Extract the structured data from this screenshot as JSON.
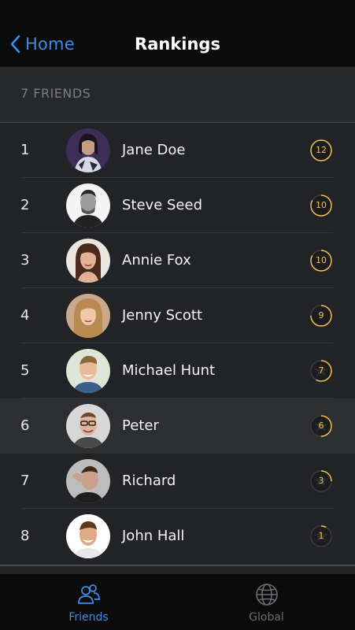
{
  "nav": {
    "back_label": "Home",
    "title": "Rankings"
  },
  "section": {
    "header": "7 FRIENDS"
  },
  "rows": [
    {
      "rank": "1",
      "name": "Jane Doe",
      "score": "12",
      "progress": 1.0
    },
    {
      "rank": "2",
      "name": "Steve Seed",
      "score": "10",
      "progress": 0.83
    },
    {
      "rank": "3",
      "name": "Annie Fox",
      "score": "10",
      "progress": 0.83
    },
    {
      "rank": "4",
      "name": "Jenny Scott",
      "score": "9",
      "progress": 0.75
    },
    {
      "rank": "5",
      "name": "Michael Hunt",
      "score": "7",
      "progress": 0.58
    },
    {
      "rank": "6",
      "name": "Peter",
      "score": "6",
      "progress": 0.5
    },
    {
      "rank": "7",
      "name": "Richard",
      "score": "3",
      "progress": 0.25
    },
    {
      "rank": "8",
      "name": "John Hall",
      "score": "1",
      "progress": 0.08
    }
  ],
  "tabs": [
    {
      "label": "Friends",
      "icon": "friends-icon",
      "active": true
    },
    {
      "label": "Global",
      "icon": "globe-icon",
      "active": false
    }
  ],
  "colors": {
    "accent": "#3a8ee6",
    "score_ring": "#f0c04a",
    "nav_bg": "#0b0b0c",
    "list_bg": "#222326"
  }
}
